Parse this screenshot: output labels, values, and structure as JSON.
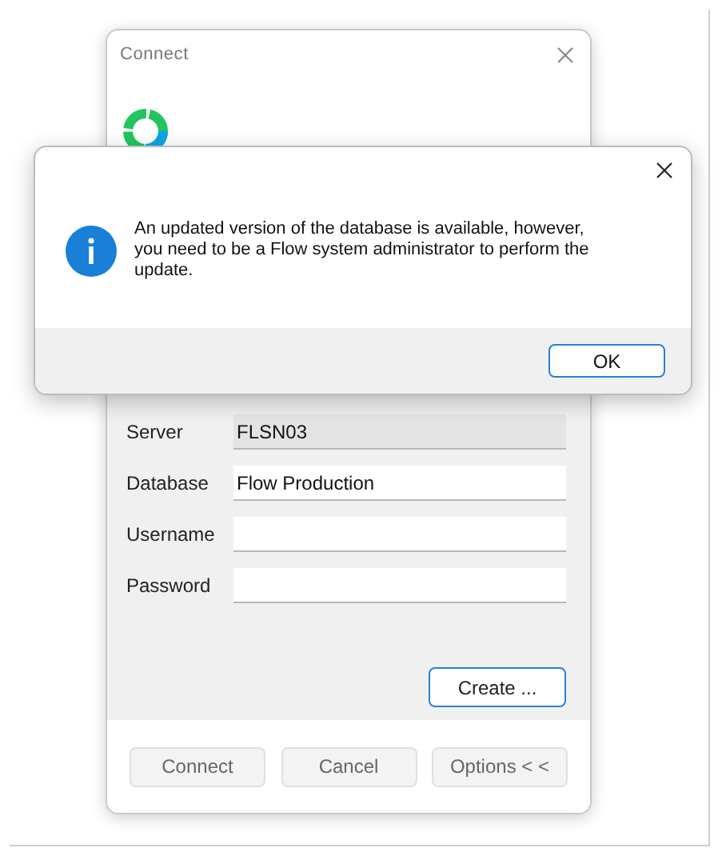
{
  "connect_window": {
    "title": "Connect",
    "fields": [
      {
        "label": "Server",
        "value": "FLSN03",
        "disabled": true
      },
      {
        "label": "Database",
        "value": "Flow Production",
        "disabled": false
      },
      {
        "label": "Username",
        "disabled": false
      },
      {
        "label": "Password",
        "disabled": false
      }
    ],
    "create_button": "Create ...",
    "buttons": [
      "Connect",
      "Cancel",
      "Options < <"
    ]
  },
  "message_box": {
    "message": "An updated version of the database is available, however, you need to be a Flow system administrator to perform the update.",
    "buttons": [
      "OK"
    ]
  }
}
